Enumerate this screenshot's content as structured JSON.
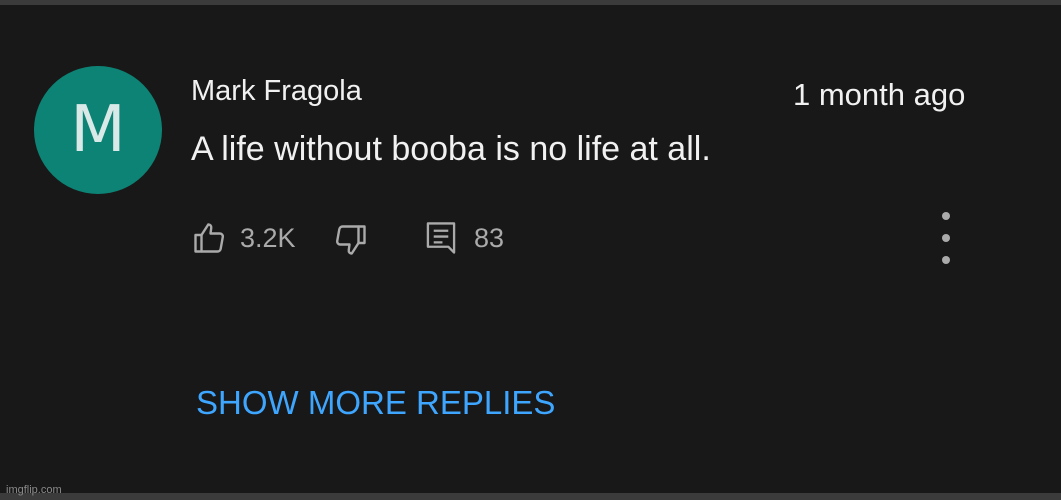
{
  "comment": {
    "avatar_initial": "M",
    "author": "Mark Fragola",
    "time": "1 month ago",
    "text": "A life without booba is no life at all.",
    "likes": "3.2K",
    "replies": "83"
  },
  "footer": {
    "show_more_label": "SHOW MORE REPLIES"
  },
  "watermark": "imgflip.com",
  "icons": {
    "like": "thumbs-up-icon",
    "dislike": "thumbs-down-icon",
    "reply": "comment-icon",
    "more": "more-vertical-icon"
  },
  "colors": {
    "background": "#181818",
    "avatar": "#0c8375",
    "accent": "#3ea6ff",
    "text": "#f1f1f1",
    "secondary": "#aaaaaa"
  }
}
